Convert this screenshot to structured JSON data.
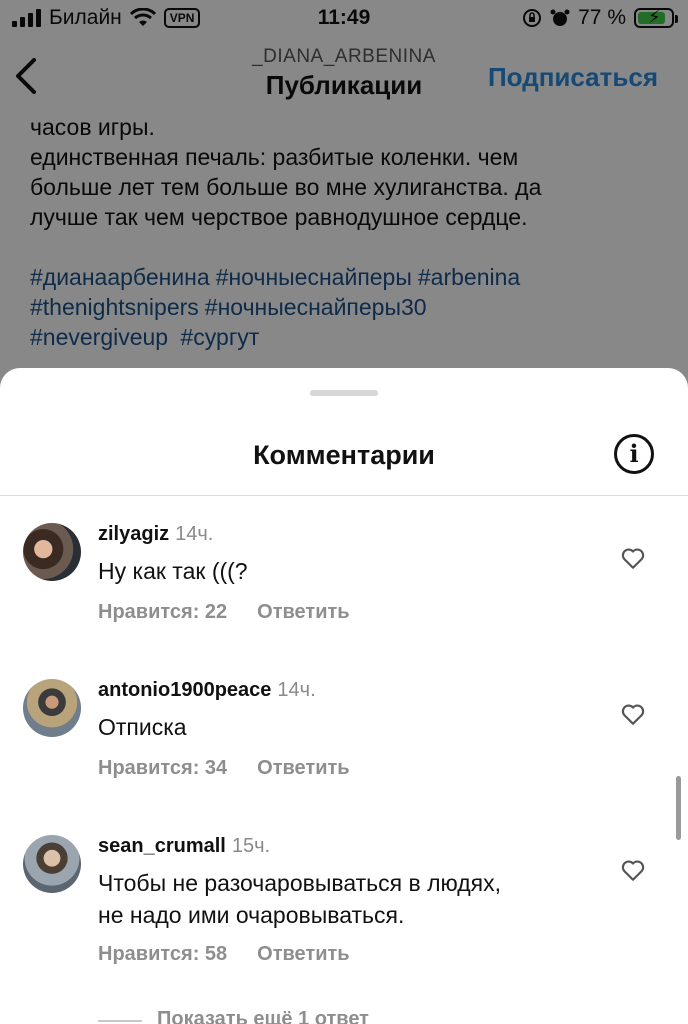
{
  "status_bar": {
    "carrier": "Билайн",
    "vpn": "VPN",
    "time": "11:49",
    "battery": "77 %",
    "battery_level": 0.77,
    "icons": [
      "signal-icon",
      "wifi-icon",
      "vpn-badge",
      "rotation-lock-icon",
      "alarm-icon",
      "battery-icon"
    ]
  },
  "nav": {
    "back_icon": "chevron-left-icon",
    "username": "_DIANA_ARBENINA",
    "title": "Публикации",
    "follow_label": "Подписаться",
    "follow_color": "#2a86d6"
  },
  "post": {
    "line0": "часов игры.",
    "line1": "единственная печаль: разбитые коленки. чем",
    "line2": "больше лет тем больше во мне хулиганства. да",
    "line3": "лучше так чем черствое равнодушное сердце.",
    "hashtags": [
      "#дианаарбенина",
      "#ночныеснайперы",
      "#arbenina",
      "#thenightsnipers",
      "#ночныеснайперы30",
      "#nevergiveup",
      "#сургут"
    ],
    "hashtag_color": "#1d4f87"
  },
  "sheet": {
    "title": "Комментарии",
    "info_icon": "info-icon",
    "comments": [
      {
        "user": "zilyagiz",
        "time": "14ч.",
        "text": "Ну как так (((?",
        "likes": "Нравится: 22",
        "reply": "Ответить"
      },
      {
        "user": "antonio1900peace",
        "time": "14ч.",
        "text": "Отписка",
        "likes": "Нравится: 34",
        "reply": "Ответить"
      },
      {
        "user": "sean_crumall",
        "time": "15ч.",
        "text_line1": "Чтобы не разочаровываться в людях,",
        "text_line2": "не надо ими очаровываться.",
        "likes": "Нравится: 58",
        "reply": "Ответить"
      }
    ],
    "show_more": "Показать ещё 1 ответ"
  }
}
